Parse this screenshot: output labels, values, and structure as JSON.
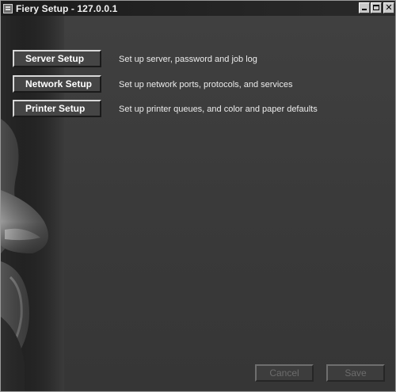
{
  "window": {
    "title": "Fiery Setup -  127.0.0.1",
    "controls": {
      "close_glyph": "✕"
    }
  },
  "setup_items": [
    {
      "label": "Server Setup",
      "description": "Set up server, password and job log"
    },
    {
      "label": "Network Setup",
      "description": "Set up network ports, protocols, and services"
    },
    {
      "label": "Printer Setup",
      "description": "Set up printer queues, and color and paper defaults"
    }
  ],
  "footer": {
    "cancel_label": "Cancel",
    "save_label": "Save",
    "cancel_enabled": false,
    "save_enabled": false
  },
  "colors": {
    "background": "#3a3a3a",
    "text": "#ececec",
    "button_face": "#454545",
    "disabled_text": "#6c6c6c"
  },
  "icons": [
    "app-icon",
    "minimize-icon",
    "maximize-icon",
    "close-icon"
  ]
}
